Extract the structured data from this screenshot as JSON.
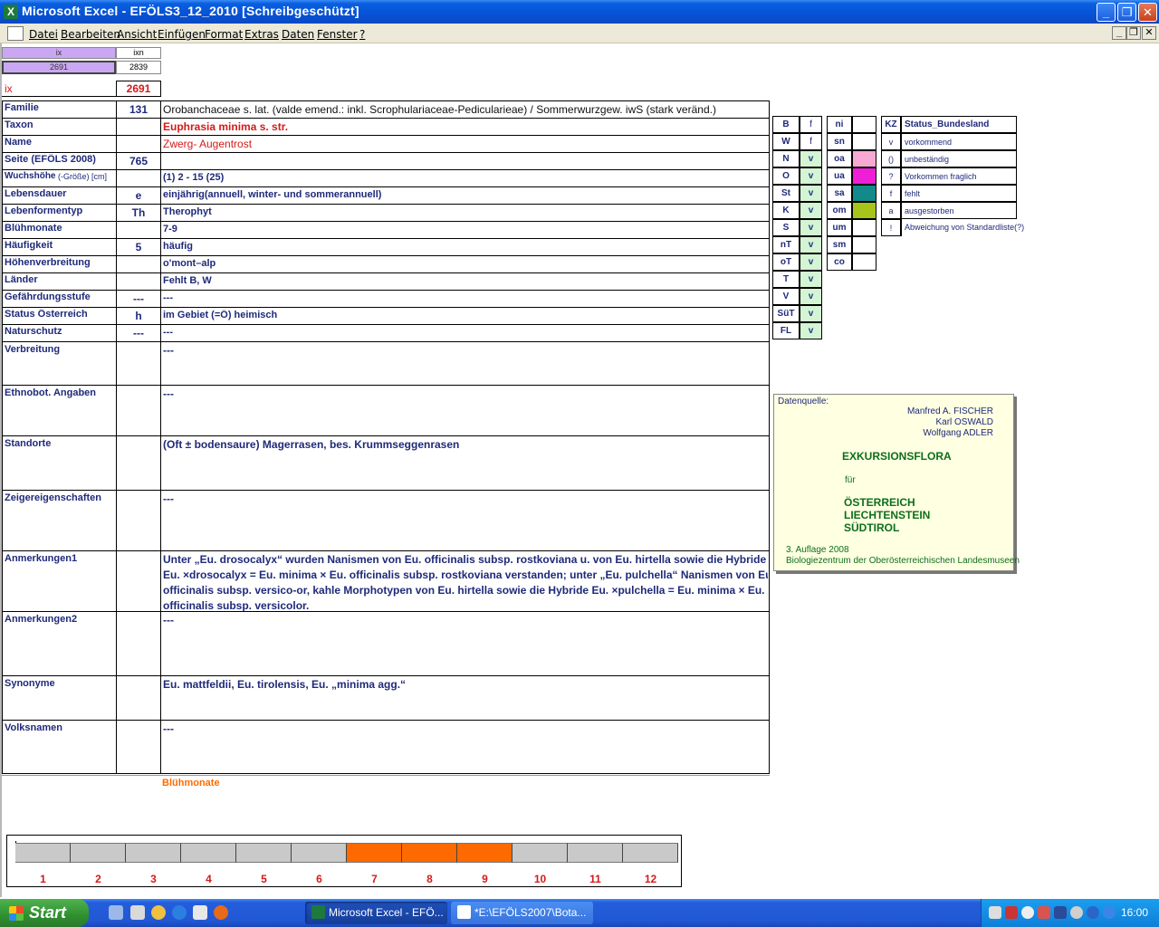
{
  "window": {
    "title": "Microsoft Excel - EFÖLS3_12_2010  [Schreibgeschützt]",
    "icon_glyph": "X"
  },
  "menu": [
    "Datei",
    "Bearbeiten",
    "Ansicht",
    "Einfügen",
    "Format",
    "Extras",
    "Daten",
    "Fenster",
    "?"
  ],
  "top_cells": {
    "ix_header": "ix",
    "ixn_header": "ixn",
    "ix_value": "2691",
    "ixn_value": "2839",
    "ix_label": "ix",
    "ix_big_value": "2691"
  },
  "rows": [
    {
      "label": "Familie",
      "code": "131",
      "value": "Orobanchaceae s. lat. (valde emend.: inkl. Scrophulariaceae-Pedicularieae)  /  Sommerwurzgew. iwS (stark veränd.)"
    },
    {
      "label": "Taxon",
      "code": "",
      "value": "Euphrasia minima s. str."
    },
    {
      "label": "Name",
      "code": "",
      "value": "Zwerg- Augentrost"
    },
    {
      "label": "Seite (EFÖLS 2008)",
      "code": "765",
      "value": ""
    },
    {
      "label": "Wuchshöhe",
      "label_extra": "(-Größe) [cm]",
      "code": "",
      "value": "(1) 2 - 15 (25)"
    },
    {
      "label": "Lebensdauer",
      "code": "e",
      "value": "einjährig(annuell, winter- und sommerannuell)"
    },
    {
      "label": "Lebenformentyp",
      "code": "Th",
      "value": "Therophyt"
    },
    {
      "label": "Blühmonate",
      "code": "",
      "value": "7-9"
    },
    {
      "label": "Häufigkeit",
      "code": "5",
      "value": "häufig"
    },
    {
      "label": "Höhenverbreitung",
      "code": "",
      "value": "o'mont–alp"
    },
    {
      "label": "Länder",
      "code": "",
      "value": "Fehlt B, W"
    },
    {
      "label": "Gefährdungsstufe",
      "code": "---",
      "value": "---"
    },
    {
      "label": "Status Österreich",
      "code": "h",
      "value": "im Gebiet (=Ö) heimisch"
    },
    {
      "label": "Naturschutz",
      "code": "---",
      "value": "---"
    }
  ],
  "large_rows": [
    {
      "label": "Verbreitung",
      "value": "---"
    },
    {
      "label": "Ethnobot. Angaben",
      "value": "---"
    },
    {
      "label": "Standorte",
      "value": "(Oft ± bodensaure) Magerrasen, bes. Krummseggenrasen"
    },
    {
      "label": "Zeigereigenschaften",
      "value": "---"
    },
    {
      "label": "Anmerkungen1",
      "lines": [
        "Unter „Eu. drosocalyx“ wurden Nanismen von Eu. officinalis subsp. rostkoviana u. von Eu. hirtella sowie die Hybride",
        "Eu. ×drosocalyx = Eu. minima × Eu. officinalis subsp. rostkoviana verstanden; unter „Eu. pulchella“ Nanismen von Eu.",
        "officinalis subsp. versico-or, kahle Morphotypen von Eu. hirtella sowie die Hybride Eu. ×pulchella = Eu. minima × Eu.",
        "officinalis subsp. versicolor."
      ]
    },
    {
      "label": "Anmerkungen2",
      "value": "---"
    },
    {
      "label": "Synonyme",
      "value": "Eu. mattfeldii, Eu. tirolensis, Eu. „minima agg.“"
    },
    {
      "label": "Volksnamen",
      "value": "---"
    }
  ],
  "legend1": {
    "header": [
      "B",
      "f"
    ],
    "rows": [
      [
        "W",
        "f"
      ],
      [
        "N",
        "v"
      ],
      [
        "O",
        "v"
      ],
      [
        "St",
        "v"
      ],
      [
        "K",
        "v"
      ],
      [
        "S",
        "v"
      ],
      [
        "nT",
        "v"
      ],
      [
        "oT",
        "v"
      ],
      [
        "T",
        "v"
      ],
      [
        "V",
        "v"
      ],
      [
        "SüT",
        "v"
      ],
      [
        "FL",
        "v"
      ]
    ]
  },
  "legend2": {
    "rows": [
      {
        "code": "ni",
        "color": ""
      },
      {
        "code": "sn",
        "color": ""
      },
      {
        "code": "oa",
        "color": "#f7a8d3"
      },
      {
        "code": "ua",
        "color": "#ee1fd6"
      },
      {
        "code": "sa",
        "color": "#128a8a"
      },
      {
        "code": "om",
        "color": "#a6c41a"
      },
      {
        "code": "um",
        "color": ""
      },
      {
        "code": "sm",
        "color": ""
      },
      {
        "code": "co",
        "color": ""
      }
    ]
  },
  "legend3": {
    "header_code": "KZ",
    "header_label": "Status_Bundesland",
    "rows": [
      {
        "code": "v",
        "label": "vorkommend"
      },
      {
        "code": "()",
        "label": "unbeständig"
      },
      {
        "code": "?",
        "label": "Vorkommen fraglich"
      },
      {
        "code": "f",
        "label": "fehlt"
      },
      {
        "code": "a",
        "label": "ausgestorben"
      },
      {
        "code": "!",
        "label": "Abweichung von Standardliste(?)"
      }
    ]
  },
  "source": {
    "label": "Datenquelle:",
    "authors": [
      "Manfred A. FISCHER",
      "Karl OSWALD",
      "Wolfgang ADLER"
    ],
    "title": "EXKURSIONSFLORA",
    "fuer": "für",
    "regions": [
      "ÖSTERREICH",
      "LIECHTENSTEIN",
      "SÜDTIROL"
    ],
    "edition": "3. Auflage 2008",
    "publisher": "Biologiezentrum der Oberösterreichischen Landesmuseen"
  },
  "bloom": {
    "title": "Blühmonate",
    "months": [
      "1",
      "2",
      "3",
      "4",
      "5",
      "6",
      "7",
      "8",
      "9",
      "10",
      "11",
      "12"
    ],
    "active": [
      7,
      8,
      9
    ],
    "active_color": "#ff6a00",
    "inactive_color": "#c9c9c9"
  },
  "taskbar": {
    "start": "Start",
    "tasks": [
      "Microsoft Excel - EFÖ...",
      "*E:\\EFÖLS2007\\Bota..."
    ],
    "clock": "16:00"
  }
}
